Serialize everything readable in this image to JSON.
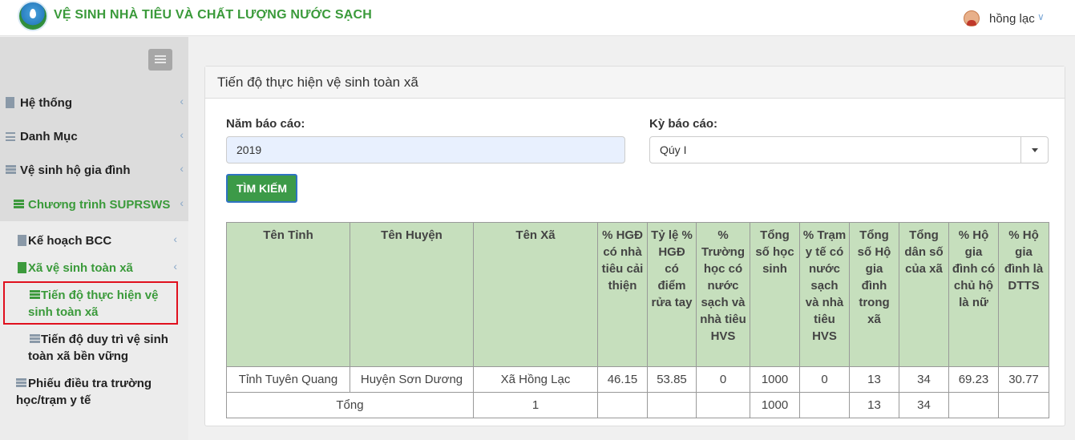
{
  "app": {
    "title": "VỆ SINH NHÀ TIÊU VÀ CHẤT LƯỢNG NƯỚC SẠCH"
  },
  "user": {
    "name": "hồng lạc",
    "caret": "∨"
  },
  "sidebar": {
    "chevron": "‹",
    "items": [
      {
        "label": "Hệ thống",
        "icon": "file-icon"
      },
      {
        "label": "Danh Mục",
        "icon": "list-icon"
      },
      {
        "label": "Vệ sinh hộ gia đình",
        "icon": "server-icon"
      },
      {
        "label": "Chương trình SUPRSWS",
        "icon": "server-icon"
      },
      {
        "label": "Kế hoạch BCC",
        "icon": "file-icon"
      },
      {
        "label": "Xã vệ sinh toàn xã",
        "icon": "file-icon"
      },
      {
        "label_line1": "Tiến độ thực hiện vệ",
        "label_line2": "sinh toàn xã",
        "icon": "server-icon"
      },
      {
        "label_line1": "Tiến độ duy trì vệ sinh",
        "label_line2": "toàn xã bền vững",
        "icon": "server-icon"
      },
      {
        "label_line1": "Phiếu điều tra trường",
        "label_line2": "học/trạm y tế",
        "icon": "server-icon"
      }
    ],
    "accent_color": "#3a9a3a",
    "highlight_color": "#e0101e"
  },
  "panel": {
    "title": "Tiến độ thực hiện vệ sinh toàn xã",
    "year_label": "Năm báo cáo:",
    "year_value": "2019",
    "period_label": "Kỳ báo cáo:",
    "period_value": "Qúy I",
    "search_label": "TÌM KIẾM"
  },
  "table": {
    "headers": [
      "Tên Tỉnh",
      "Tên Huyện",
      "Tên Xã",
      "% HGĐ có nhà tiêu cải thiện",
      "Tỷ lệ % HGĐ có điểm rửa tay",
      "% Trường học có nước sạch và nhà tiêu HVS",
      "Tổng số học sinh",
      "% Trạm y tế có nước sạch và nhà tiêu HVS",
      "Tổng số Hộ gia đình trong xã",
      "Tổng dân số của xã",
      "% Hộ gia đình có chủ hộ là nữ",
      "% Hộ gia đình là DTTS"
    ],
    "rows": [
      [
        "Tỉnh Tuyên Quang",
        "Huyện Sơn Dương",
        "Xã Hồng Lạc",
        "46.15",
        "53.85",
        "0",
        "1000",
        "0",
        "13",
        "34",
        "69.23",
        "30.77"
      ]
    ],
    "total_row": [
      "Tổng",
      "1",
      "",
      "",
      "",
      "1000",
      "",
      "13",
      "34",
      "",
      ""
    ],
    "header_bg": "#c6dfbd"
  }
}
